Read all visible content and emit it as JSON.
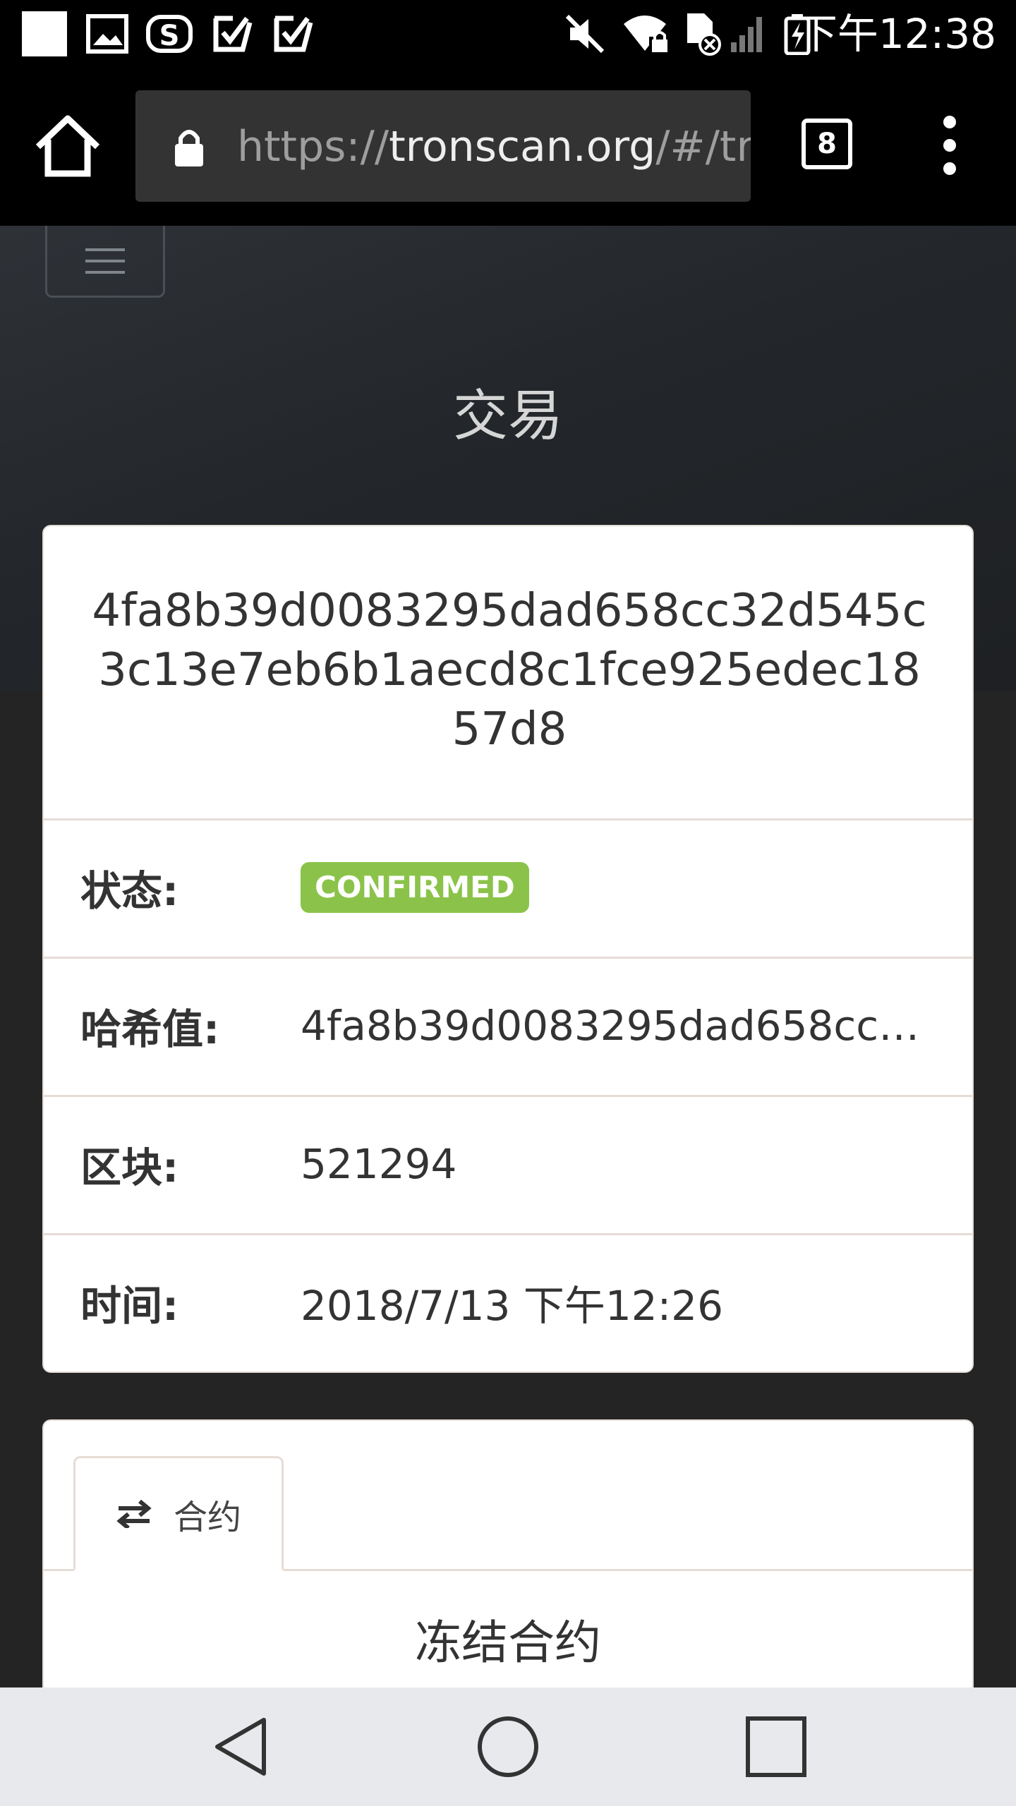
{
  "status_bar": {
    "time": "下午12:38",
    "icons": [
      "square-icon",
      "image-icon",
      "app-s-icon",
      "check-notif-icon",
      "check-notif-icon",
      "mute-icon",
      "wifi-lock-icon",
      "sim-off-icon",
      "signal-icon",
      "battery-charging-icon"
    ]
  },
  "browser": {
    "url_scheme": "https://",
    "url_domain": "tronscan.org",
    "url_path": "/#/tr",
    "tab_count": "8"
  },
  "page": {
    "title": "交易"
  },
  "transaction": {
    "hash_full": "4fa8b39d0083295dad658cc32d545c3c13e7eb6b1aecd8c1fce925edec1857d8",
    "fields": [
      {
        "label": "状态:",
        "value": "CONFIRMED"
      },
      {
        "label": "哈希值:",
        "value": "4fa8b39d0083295dad658cc3…"
      },
      {
        "label": "区块:",
        "value": "521294"
      },
      {
        "label": "时间:",
        "value": "2018/7/13 下午12:26"
      }
    ]
  },
  "contract_section": {
    "tab_label": "合约",
    "heading": "冻结合约"
  },
  "colors": {
    "badge_confirmed": "#8bc34a",
    "page_bg": "#242424",
    "card_bg": "#ffffff"
  }
}
